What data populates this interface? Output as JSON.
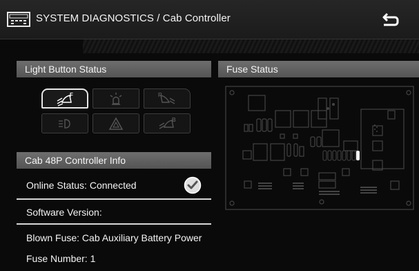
{
  "header": {
    "title": "SYSTEM DIAGNOSTICS / Cab Controller",
    "title_icon": "diagnostics-module-icon",
    "back_icon": "return-arrow-icon"
  },
  "light_button_status": {
    "title": "Light Button Status",
    "buttons": [
      {
        "icon": "front-work-light-icon",
        "state": "active"
      },
      {
        "icon": "beacon-light-icon",
        "state": "inactive"
      },
      {
        "icon": "rear-work-light-icon",
        "state": "inactive"
      },
      {
        "icon": "headlight-icon",
        "state": "inactive"
      },
      {
        "icon": "hazard-warning-icon",
        "state": "inactive"
      },
      {
        "icon": "boom-work-light-icon",
        "state": "inactive"
      }
    ]
  },
  "fuse_status": {
    "title": "Fuse Status",
    "highlighted_fuse": "white-fuse-indicator"
  },
  "controller_info": {
    "title": "Cab 48P Controller Info",
    "online_status": "Online Status: Connected",
    "online_status_icon": "check-circle-icon",
    "software_version": "Software Version:",
    "blown_fuse": "Blown Fuse: Cab Auxiliary Battery Power",
    "fuse_number": "Fuse Number: 1"
  },
  "colors": {
    "background": "#0a0a0a",
    "header_bar": "#5f5f5f",
    "text": "#f4f4f4",
    "board_line": "#444444"
  }
}
